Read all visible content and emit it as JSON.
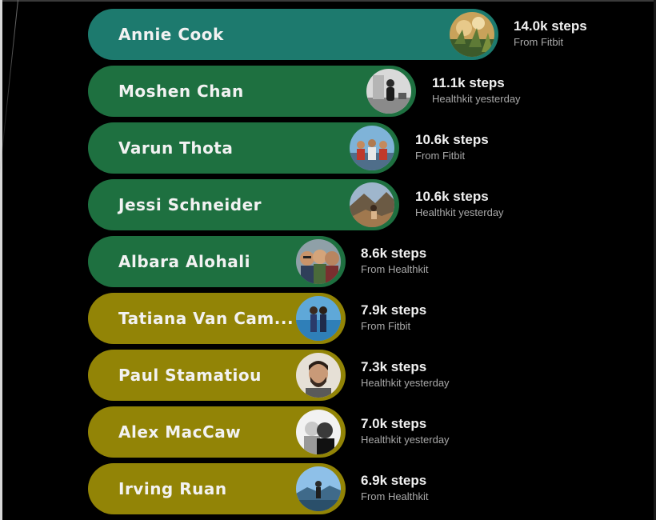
{
  "colors": {
    "teal": "#1d7a6e",
    "green": "#1e7040",
    "olive": "#928406",
    "background": "#000000"
  },
  "leaderboard": [
    {
      "name": "Annie Cook",
      "steps": "14.0k steps",
      "source": "From Fitbit",
      "color": "#1d7a6e",
      "avatar": "leaves"
    },
    {
      "name": "Moshen Chan",
      "steps": "11.1k steps",
      "source": "Healthkit yesterday",
      "color": "#1e7040",
      "avatar": "person-bw"
    },
    {
      "name": "Varun Thota",
      "steps": "10.6k steps",
      "source": "From Fitbit",
      "color": "#1e7040",
      "avatar": "group-sky"
    },
    {
      "name": "Jessi Schneider",
      "steps": "10.6k steps",
      "source": "Healthkit yesterday",
      "color": "#1e7040",
      "avatar": "mountain"
    },
    {
      "name": "Albara Alohali",
      "steps": "8.6k steps",
      "source": "From Healthkit",
      "color": "#1e7040",
      "avatar": "friends"
    },
    {
      "name": "Tatiana Van Cam...",
      "steps": "7.9k steps",
      "source": "From Fitbit",
      "color": "#928406",
      "avatar": "couple-water"
    },
    {
      "name": "Paul Stamatiou",
      "steps": "7.3k steps",
      "source": "Healthkit yesterday",
      "color": "#928406",
      "avatar": "face"
    },
    {
      "name": "Alex MacCaw",
      "steps": "7.0k steps",
      "source": "Healthkit yesterday",
      "color": "#928406",
      "avatar": "selfie-bw"
    },
    {
      "name": "Irving Ruan",
      "steps": "6.9k steps",
      "source": "From Healthkit",
      "color": "#928406",
      "avatar": "landscape"
    }
  ]
}
